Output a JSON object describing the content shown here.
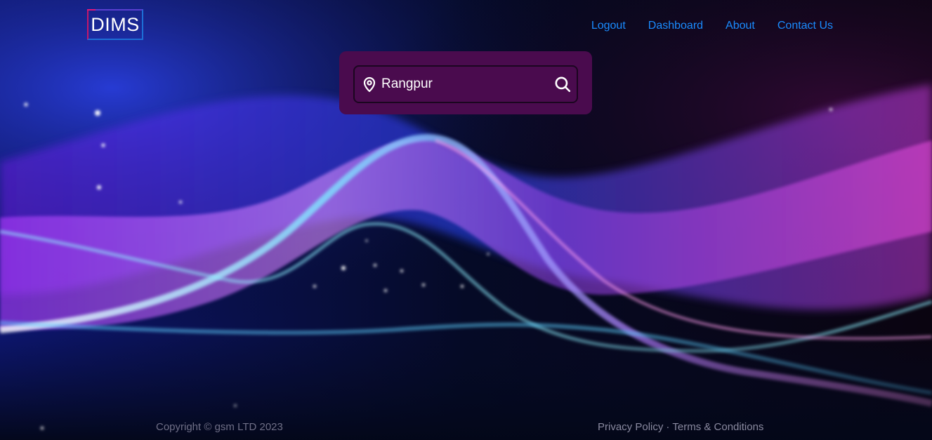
{
  "header": {
    "logo_text": "DIMS",
    "nav": {
      "logout": "Logout",
      "dashboard": "Dashboard",
      "about": "About",
      "contact": "Contact Us"
    }
  },
  "search": {
    "value": "Rangpur",
    "location_icon": "location-pin-icon",
    "submit_icon": "search-icon"
  },
  "footer": {
    "copyright": "Copyright © gsm LTD 2023",
    "privacy": "Privacy Policy",
    "separator": "·",
    "terms": "Terms & Conditions"
  },
  "colors": {
    "nav_link": "#1a8cff",
    "search_card": "#4a0b4e",
    "background": "#050a24"
  }
}
